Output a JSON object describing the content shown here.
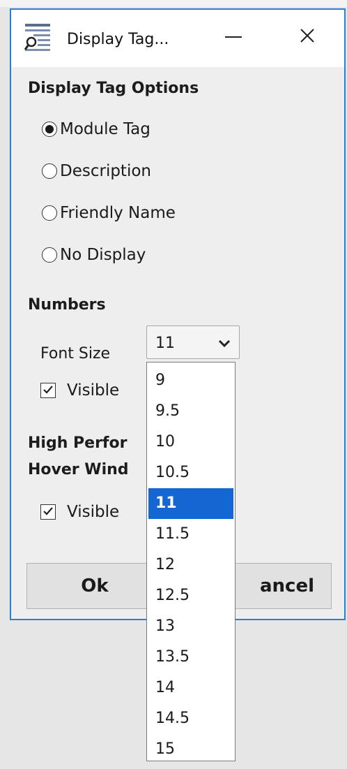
{
  "window": {
    "title": "Display Tag...",
    "minimize_glyph": "—",
    "close_glyph": "✕"
  },
  "display_tag_options": {
    "heading": "Display Tag Options",
    "selected": "Module Tag",
    "options": [
      "Module Tag",
      "Description",
      "Friendly Name",
      "No Display"
    ]
  },
  "numbers": {
    "heading": "Numbers",
    "font_size_label": "Font Size",
    "font_size_value": "11",
    "visible_label": "Visible",
    "visible_checked": true
  },
  "hover": {
    "heading_line1": "High Perfor",
    "heading_line2": "Hover Wind",
    "visible_label": "Visible",
    "visible_checked": true
  },
  "buttons": {
    "ok_label": "Ok",
    "cancel_label": "ancel"
  },
  "font_size_dropdown": {
    "options": [
      "9",
      "9.5",
      "10",
      "10.5",
      "11",
      "11.5",
      "12",
      "12.5",
      "13",
      "13.5",
      "14",
      "14.5",
      "15"
    ],
    "selected": "11"
  },
  "colors": {
    "accent": "#2a7fd4",
    "selection": "#1466d2"
  },
  "icons": {
    "app": "list-search-icon",
    "dropdown": "chevron-down-icon",
    "check": "check-icon"
  }
}
